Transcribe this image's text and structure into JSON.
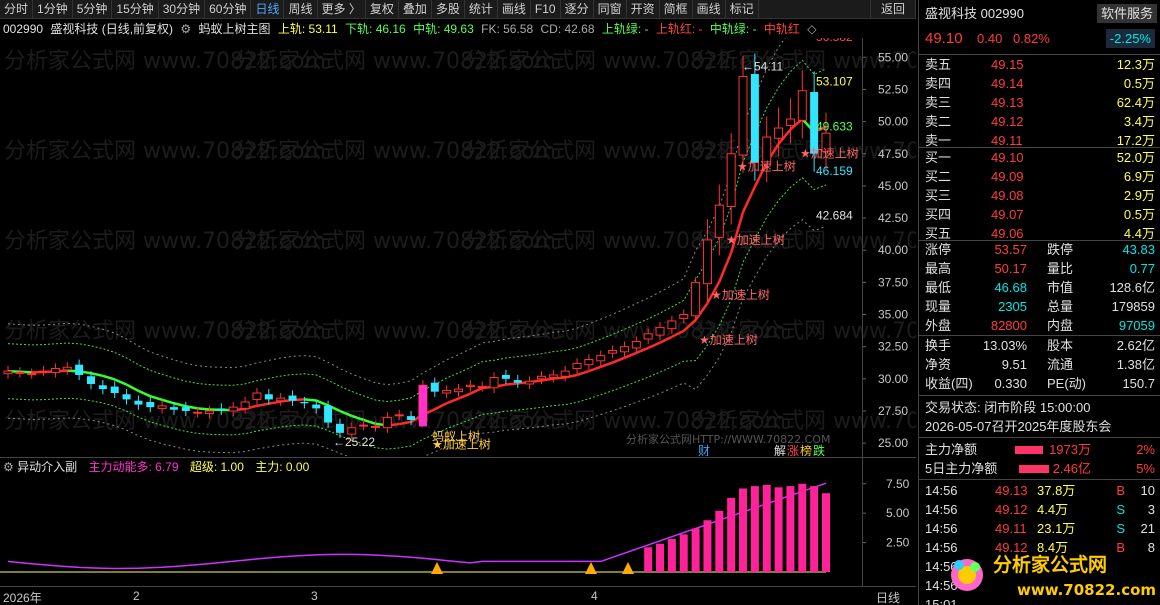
{
  "toolbar": {
    "items": [
      "分时",
      "1分钟",
      "5分钟",
      "15分钟",
      "30分钟",
      "60分钟",
      "日线",
      "周线",
      "更多 〉",
      "复权",
      "叠加",
      "多股",
      "统计",
      "画线",
      "F10",
      "逐分",
      "同窗",
      "开资",
      "简框",
      "画线",
      "标记"
    ],
    "active": "日线",
    "back_label": "返回"
  },
  "infobar": {
    "code": "002990",
    "name": "盛视科技 (日线,前复权)",
    "indicator_name": "蚂蚁上树主图",
    "upper_label": "上轨: 53.11",
    "lower_label": "下轨: 46.16",
    "mid_label": "中轨: 49.63",
    "fk_label": "FK: 56.58",
    "cd_label": "CD: 42.68",
    "up_green": "上轨绿: -",
    "up_red": "上轨红: -",
    "mid_green": "中轨绿: -",
    "mid_red": "中轨红"
  },
  "price_axis": [
    "55.00",
    "52.50",
    "50.00",
    "47.50",
    "45.00",
    "42.50",
    "40.00",
    "37.50",
    "35.00",
    "32.50",
    "30.00",
    "27.50",
    "25.00"
  ],
  "chart_labels": {
    "high": "54.11",
    "low": "25.22",
    "fk": "56.582",
    "upper": "53.107",
    "mid": "49.633",
    "lower": "46.159",
    "cd": "42.684",
    "accel": "★加速上树",
    "ant": "蚂蚁上树",
    "wm_center": "分析家公式网HTTP://WWW.70822.COM",
    "fin_marker": "财",
    "jie_marker": "解",
    "zhang_marker": "涨",
    "bang_marker": "榜",
    "die_marker": "跌"
  },
  "sub": {
    "title": "异动介入副",
    "main_power_more": "主力动能多: 6.79",
    "super": "超级: 1.00",
    "main_power": "主力: 0.00",
    "axis": [
      "7.50",
      "5.00",
      "2.50"
    ]
  },
  "xaxis": {
    "labels": [
      "2026年",
      "2",
      "3",
      "4"
    ],
    "period": "日线"
  },
  "quote": {
    "name": "盛视科技 002990",
    "service": "软件服务",
    "price": "49.10",
    "change": "0.40",
    "pct": "0.82%",
    "service_pct": "-2.25%",
    "sells": [
      {
        "label": "卖五",
        "price": "49.15",
        "vol": "12.3万"
      },
      {
        "label": "卖四",
        "price": "49.14",
        "vol": "0.5万"
      },
      {
        "label": "卖三",
        "price": "49.13",
        "vol": "62.4万"
      },
      {
        "label": "卖二",
        "price": "49.12",
        "vol": "3.4万"
      },
      {
        "label": "卖一",
        "price": "49.11",
        "vol": "17.2万"
      }
    ],
    "buys": [
      {
        "label": "买一",
        "price": "49.10",
        "vol": "52.0万"
      },
      {
        "label": "买二",
        "price": "49.09",
        "vol": "6.9万"
      },
      {
        "label": "买三",
        "price": "49.08",
        "vol": "2.9万"
      },
      {
        "label": "买四",
        "price": "49.07",
        "vol": "0.5万"
      },
      {
        "label": "买五",
        "price": "49.06",
        "vol": "4.4万"
      }
    ],
    "stats": [
      {
        "l1": "涨停",
        "v1": "53.57",
        "c1": "red",
        "l2": "跌停",
        "v2": "43.83",
        "c2": "green"
      },
      {
        "l1": "最高",
        "v1": "50.17",
        "c1": "red",
        "l2": "量比",
        "v2": "0.77",
        "c2": "green"
      },
      {
        "l1": "最低",
        "v1": "46.68",
        "c1": "green",
        "l2": "市值",
        "v2": "128.6亿",
        "c2": "white"
      },
      {
        "l1": "现量",
        "v1": "2305",
        "c1": "green",
        "l2": "总量",
        "v2": "179859",
        "c2": "white"
      },
      {
        "l1": "外盘",
        "v1": "82800",
        "c1": "red",
        "l2": "内盘",
        "v2": "97059",
        "c2": "green"
      }
    ],
    "stats2": [
      {
        "l1": "换手",
        "v1": "13.03%",
        "l2": "股本",
        "v2": "2.62亿"
      },
      {
        "l1": "净资",
        "v1": "9.51",
        "l2": "流通",
        "v2": "1.38亿"
      },
      {
        "l1": "收益(四)",
        "v1": "0.330",
        "l2": "PE(动)",
        "v2": "150.7"
      }
    ],
    "trade_status": "交易状态: 闭市阶段 15:00:00",
    "notice": "2026-05-07召开2025年度股东会",
    "flow1_label": "主力净额",
    "flow1_val": "1973万",
    "flow1_pct": "2%",
    "flow2_label": "5日主力净额",
    "flow2_val": "2.46亿",
    "flow2_pct": "5%",
    "ticks": [
      {
        "t": "14:56",
        "p": "49.13",
        "v": "37.8万",
        "d": "B",
        "n": "10"
      },
      {
        "t": "14:56",
        "p": "49.12",
        "v": "4.4万",
        "d": "S",
        "n": "3"
      },
      {
        "t": "14:56",
        "p": "49.11",
        "v": "23.1万",
        "d": "S",
        "n": "21"
      },
      {
        "t": "14:56",
        "p": "49.12",
        "v": "8.4万",
        "d": "B",
        "n": "8"
      },
      {
        "t": "14:56",
        "p": "",
        "v": "",
        "d": "",
        "n": ""
      },
      {
        "t": "14:56",
        "p": "",
        "v": "",
        "d": "",
        "n": ""
      },
      {
        "t": "15:01",
        "p": "",
        "v": "",
        "d": "",
        "n": ""
      }
    ],
    "logo_text": "分析家公式网",
    "logo_url": "www.70822.com"
  },
  "watermark_text": "分析家公式网 www.70822.com",
  "chart_data": {
    "type": "candlestick",
    "closes": [
      30.6,
      30.5,
      30.4,
      30.6,
      30.8,
      30.9,
      30.3,
      29.6,
      29.2,
      28.9,
      28.4,
      28.0,
      27.8,
      27.9,
      27.6,
      27.5,
      27.4,
      27.5,
      27.6,
      27.8,
      28.2,
      28.9,
      28.4,
      28.5,
      28.3,
      28.1,
      27.7,
      26.6,
      25.8,
      26.2,
      26.4,
      26.3,
      27.0,
      27.2,
      26.8,
      29.5,
      29.0,
      29.1,
      29.2,
      29.5,
      29.4,
      30.1,
      30.0,
      29.7,
      29.8,
      30.2,
      30.3,
      30.6,
      31.2,
      31.5,
      31.8,
      32.2,
      32.5,
      32.9,
      33.5,
      34.0,
      34.5,
      35.0,
      37.5,
      40.8,
      43.5,
      47.5,
      53.5,
      46.8,
      48.8,
      49.5,
      50.2,
      52.4,
      47.5,
      49.1
    ],
    "price_range": [
      24.0,
      56.5
    ],
    "upper_band_last": 53.107,
    "mid_band_last": 49.633,
    "lower_band_last": 46.159,
    "fk_last": 56.582,
    "cd_last": 42.684,
    "sub_range": [
      0,
      8.5
    ],
    "sub_bars_last": [
      2.1,
      2.4,
      2.8,
      3.2,
      3.7,
      4.4,
      5.2,
      6.3,
      7.1,
      7.3,
      7.4,
      7.2,
      7.3,
      7.5,
      7.3,
      6.7
    ]
  }
}
